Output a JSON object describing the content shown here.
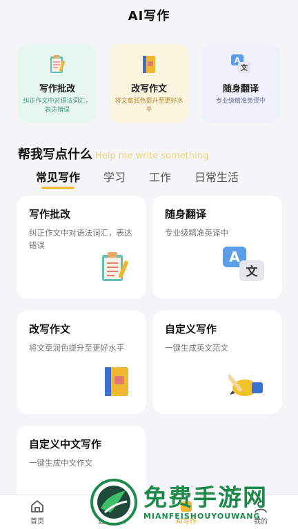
{
  "header": {
    "title": "AI写作"
  },
  "quick_cards": [
    {
      "title": "写作批改",
      "desc": "纠正作文中对语法词汇，表达错误",
      "icon": "clipboard-pencil-icon"
    },
    {
      "title": "改写作文",
      "desc": "将文章润色提升至更好水平",
      "icon": "notebook-icon"
    },
    {
      "title": "随身翻译",
      "desc": "专业级精准英译中",
      "icon": "translate-icon"
    }
  ],
  "section": {
    "title": "帮我写点什么",
    "subtitle": "Help me write something"
  },
  "tabs": [
    {
      "label": "常见写作",
      "active": true
    },
    {
      "label": "学习",
      "active": false
    },
    {
      "label": "工作",
      "active": false
    },
    {
      "label": "日常生活",
      "active": false
    }
  ],
  "cards": [
    {
      "title": "写作批改",
      "desc": "纠正作文中对语法词汇，表达错误",
      "icon": "clipboard-pencil-icon"
    },
    {
      "title": "随身翻译",
      "desc": "专业级精准英译中",
      "icon": "translate-icon"
    },
    {
      "title": "改写作文",
      "desc": "将文章润色提升至更好水平",
      "icon": "notebook-icon"
    },
    {
      "title": "自定义写作",
      "desc": "一键生成英文范文",
      "icon": "hand-pencil-icon"
    },
    {
      "title": "自定义中文写作",
      "desc": "一键生成中文作文",
      "icon": "hand-pencil-icon"
    }
  ],
  "bottom_nav": [
    {
      "label": "首页",
      "icon": "home-icon"
    },
    {
      "label": "选择升数",
      "icon": "level-icon"
    },
    {
      "label": "AI写作",
      "icon": "ai-write-icon",
      "active": true
    },
    {
      "label": "我的",
      "icon": "profile-icon"
    }
  ],
  "watermark": {
    "zh": "免费手游网",
    "en": "MIANFEISHOUYOUWANG"
  },
  "colors": {
    "accent": "#f0b730",
    "background": "#f5f5f7",
    "watermark": "#1d8a4c"
  }
}
